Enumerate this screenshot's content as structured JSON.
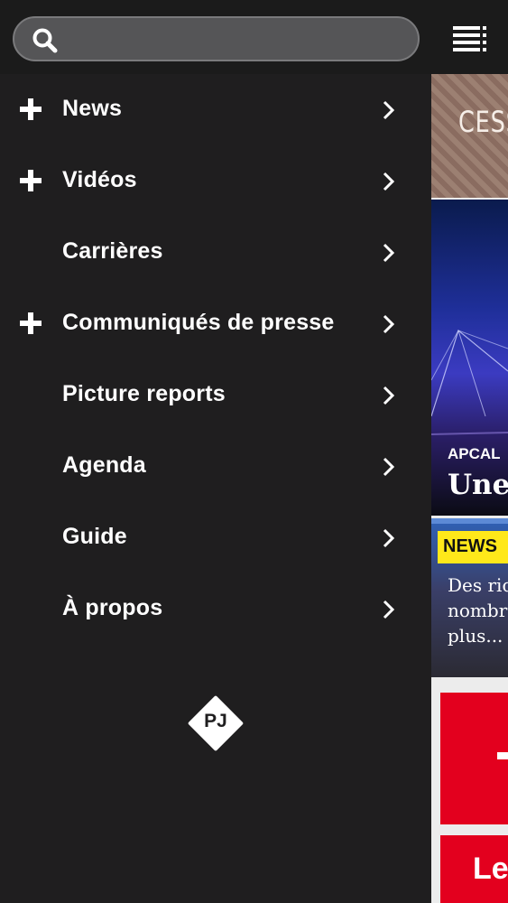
{
  "search": {
    "placeholder": ""
  },
  "menu": {
    "items": [
      {
        "label": "News",
        "expandable": true
      },
      {
        "label": "Vidéos",
        "expandable": true
      },
      {
        "label": "Carrières",
        "expandable": false
      },
      {
        "label": "Communiqués de presse",
        "expandable": true
      },
      {
        "label": "Picture reports",
        "expandable": false
      },
      {
        "label": "Agenda",
        "expandable": false
      },
      {
        "label": "Guide",
        "expandable": false
      },
      {
        "label": "À propos",
        "expandable": false
      }
    ]
  },
  "logo": {
    "text": "PJ"
  },
  "feed": {
    "banner_text": "CESS",
    "hero": {
      "category": "APCAL",
      "title": "Une"
    },
    "card2": {
      "badge": "NEWS",
      "text_lines": [
        "Des ric",
        "nombr",
        "plus..."
      ]
    },
    "card4": {
      "text": "Le"
    }
  },
  "colors": {
    "background": "#1f1e1f",
    "topbar": "#1b1b1b",
    "badge_yellow": "#ffe81a",
    "accent_red": "#e3001e"
  },
  "icons": {
    "search": "search-icon",
    "menu": "menu-list-icon",
    "expand": "plus-icon",
    "chevron": "chevron-right-icon"
  }
}
